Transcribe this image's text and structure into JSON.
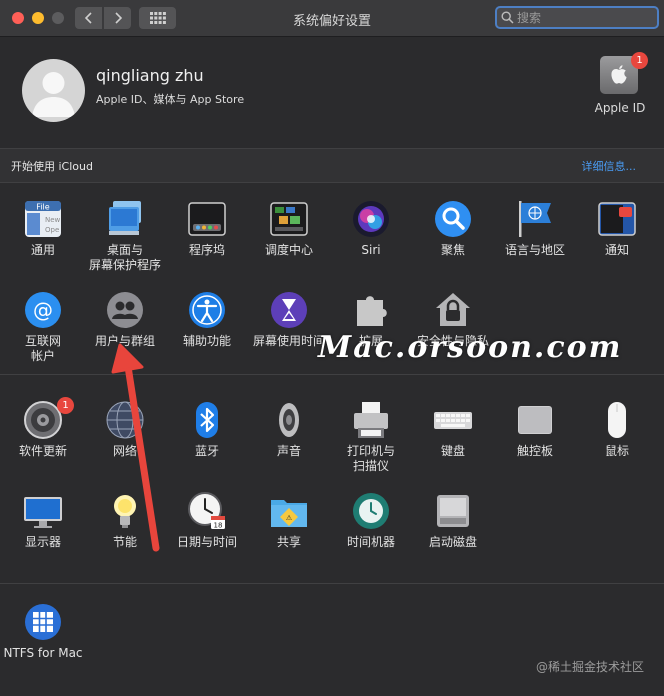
{
  "window": {
    "title": "系统偏好设置",
    "search_placeholder": "搜索",
    "traffic_lights": [
      "#ff5f57",
      "#febc2e",
      "#5c5c5e"
    ]
  },
  "account": {
    "name": "qingliang zhu",
    "subtitle": "Apple ID、媒体与 App Store",
    "apple_id_label": "Apple ID",
    "apple_id_badge": "1"
  },
  "icloud": {
    "text": "开始使用 iCloud",
    "link": "详细信息..."
  },
  "section1": {
    "row1": [
      {
        "label": "通用",
        "icon": "general-icon"
      },
      {
        "label": "桌面与\n屏幕保护程序",
        "icon": "desktop-screensaver-icon"
      },
      {
        "label": "程序坞",
        "icon": "dock-icon"
      },
      {
        "label": "调度中心",
        "icon": "mission-control-icon"
      },
      {
        "label": "Siri",
        "icon": "siri-icon"
      },
      {
        "label": "聚焦",
        "icon": "spotlight-icon"
      },
      {
        "label": "语言与地区",
        "icon": "language-region-icon"
      },
      {
        "label": "通知",
        "icon": "notifications-icon"
      }
    ],
    "row2": [
      {
        "label": "互联网\n帐户",
        "icon": "internet-accounts-icon"
      },
      {
        "label": "用户与群组",
        "icon": "users-groups-icon"
      },
      {
        "label": "辅助功能",
        "icon": "accessibility-icon"
      },
      {
        "label": "屏幕使用时间",
        "icon": "screen-time-icon"
      },
      {
        "label": "扩展",
        "icon": "extensions-icon"
      },
      {
        "label": "安全性与隐私",
        "icon": "security-privacy-icon"
      }
    ]
  },
  "section2": {
    "row1": [
      {
        "label": "软件更新",
        "icon": "software-update-icon",
        "badge": "1"
      },
      {
        "label": "网络",
        "icon": "network-icon"
      },
      {
        "label": "蓝牙",
        "icon": "bluetooth-icon"
      },
      {
        "label": "声音",
        "icon": "sound-icon"
      },
      {
        "label": "打印机与\n扫描仪",
        "icon": "printers-scanners-icon"
      },
      {
        "label": "键盘",
        "icon": "keyboard-icon"
      },
      {
        "label": "触控板",
        "icon": "trackpad-icon"
      },
      {
        "label": "鼠标",
        "icon": "mouse-icon"
      }
    ],
    "row2": [
      {
        "label": "显示器",
        "icon": "displays-icon"
      },
      {
        "label": "节能",
        "icon": "energy-saver-icon"
      },
      {
        "label": "日期与时间",
        "icon": "date-time-icon"
      },
      {
        "label": "共享",
        "icon": "sharing-icon"
      },
      {
        "label": "时间机器",
        "icon": "time-machine-icon"
      },
      {
        "label": "启动磁盘",
        "icon": "startup-disk-icon"
      }
    ]
  },
  "section3": {
    "row1": [
      {
        "label": "NTFS for Mac",
        "icon": "ntfs-for-mac-icon"
      }
    ]
  },
  "overlay": {
    "watermark": "Mac.orsoon.com",
    "credit": "@稀土掘金技术社区",
    "arrow_color": "#e8453c"
  }
}
